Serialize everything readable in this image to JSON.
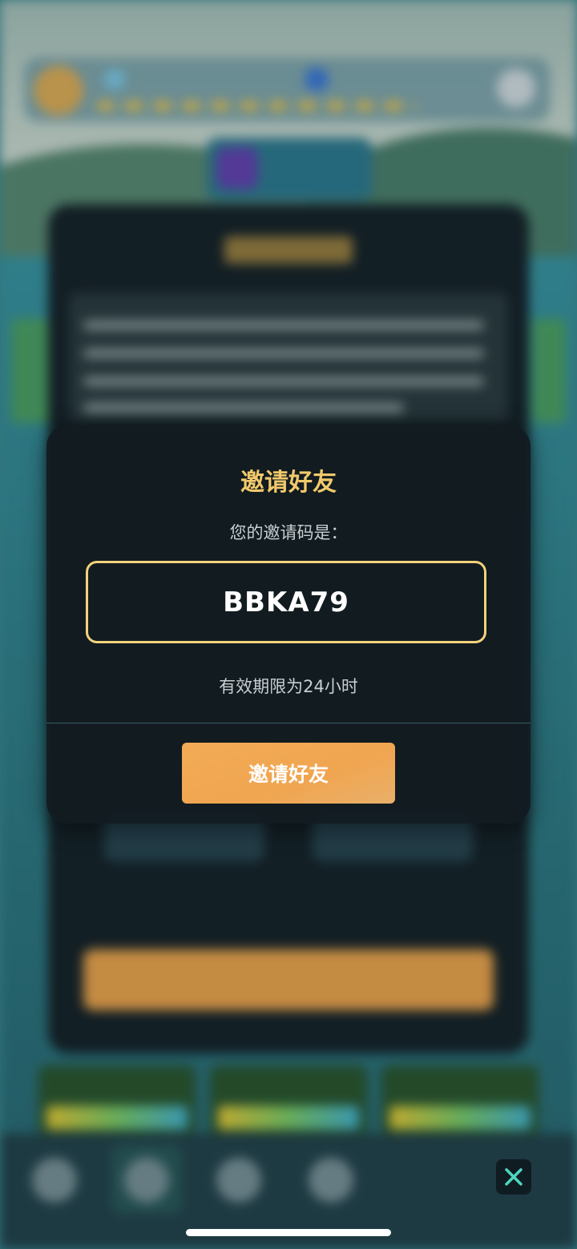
{
  "modal": {
    "title": "邀请好友",
    "prompt": "您的邀请码是：",
    "invite_code": "BBKA79",
    "validity": "有效期限为24小时",
    "button_label": "邀请好友"
  },
  "colors": {
    "title_gold": "#f2c96b",
    "code_border": "#f3d27c",
    "button_orange": "#f0a550",
    "close_icon": "#4fd6c0"
  },
  "icons": {
    "close": "close-icon"
  }
}
